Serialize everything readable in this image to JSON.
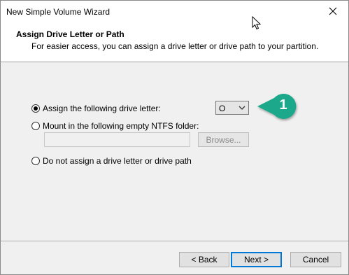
{
  "window": {
    "title": "New Simple Volume Wizard"
  },
  "header": {
    "title": "Assign Drive Letter or Path",
    "subtitle": "For easier access, you can assign a drive letter or drive path to your partition."
  },
  "options": {
    "assign_letter": {
      "label": "Assign the following drive letter:",
      "checked": true
    },
    "drive_letter": {
      "value": "O"
    },
    "mount_folder": {
      "label": "Mount in the following empty NTFS folder:",
      "checked": false,
      "path_value": ""
    },
    "browse_label": "Browse...",
    "no_assign": {
      "label": "Do not assign a drive letter or drive path",
      "checked": false
    }
  },
  "callout": {
    "number": "1",
    "color": "#1aa88a"
  },
  "footer": {
    "back_label": "< Back",
    "next_label": "Next >",
    "cancel_label": "Cancel"
  }
}
